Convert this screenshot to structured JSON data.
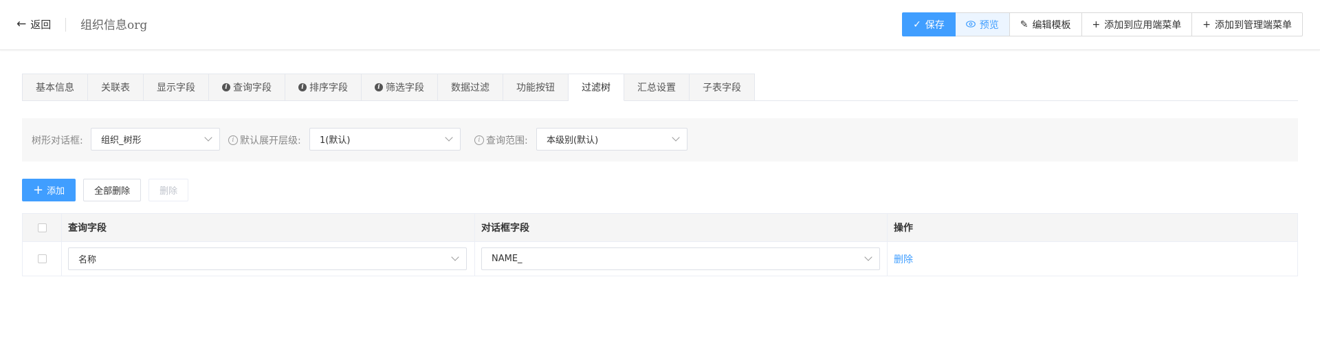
{
  "header": {
    "back_label": "返回",
    "title": "组织信息org",
    "buttons": {
      "save": "保存",
      "preview": "预览",
      "edit_template": "编辑模板",
      "add_app_menu": "添加到应用端菜单",
      "add_admin_menu": "添加到管理端菜单"
    }
  },
  "tabs": [
    {
      "label": "基本信息",
      "info": false
    },
    {
      "label": "关联表",
      "info": false
    },
    {
      "label": "显示字段",
      "info": false
    },
    {
      "label": "查询字段",
      "info": true
    },
    {
      "label": "排序字段",
      "info": true
    },
    {
      "label": "筛选字段",
      "info": true
    },
    {
      "label": "数据过滤",
      "info": false
    },
    {
      "label": "功能按钮",
      "info": false
    },
    {
      "label": "过滤树",
      "info": false,
      "active": true
    },
    {
      "label": "汇总设置",
      "info": false
    },
    {
      "label": "子表字段",
      "info": false
    }
  ],
  "filters": {
    "tree_dialog": {
      "label": "树形对话框:",
      "value": "组织_树形"
    },
    "expand_level": {
      "label": "默认展开层级:",
      "value": "1(默认)"
    },
    "query_scope": {
      "label": "查询范围:",
      "value": "本级别(默认)"
    }
  },
  "actions": {
    "add": "添加",
    "delete_all": "全部删除",
    "delete": "删除"
  },
  "table": {
    "columns": [
      "查询字段",
      "对话框字段",
      "操作"
    ],
    "rows": [
      {
        "query_field": "名称",
        "dialog_field": "NAME_",
        "action": "删除"
      }
    ]
  },
  "colors": {
    "primary": "#409eff",
    "preview_bg": "#ecf5ff"
  }
}
